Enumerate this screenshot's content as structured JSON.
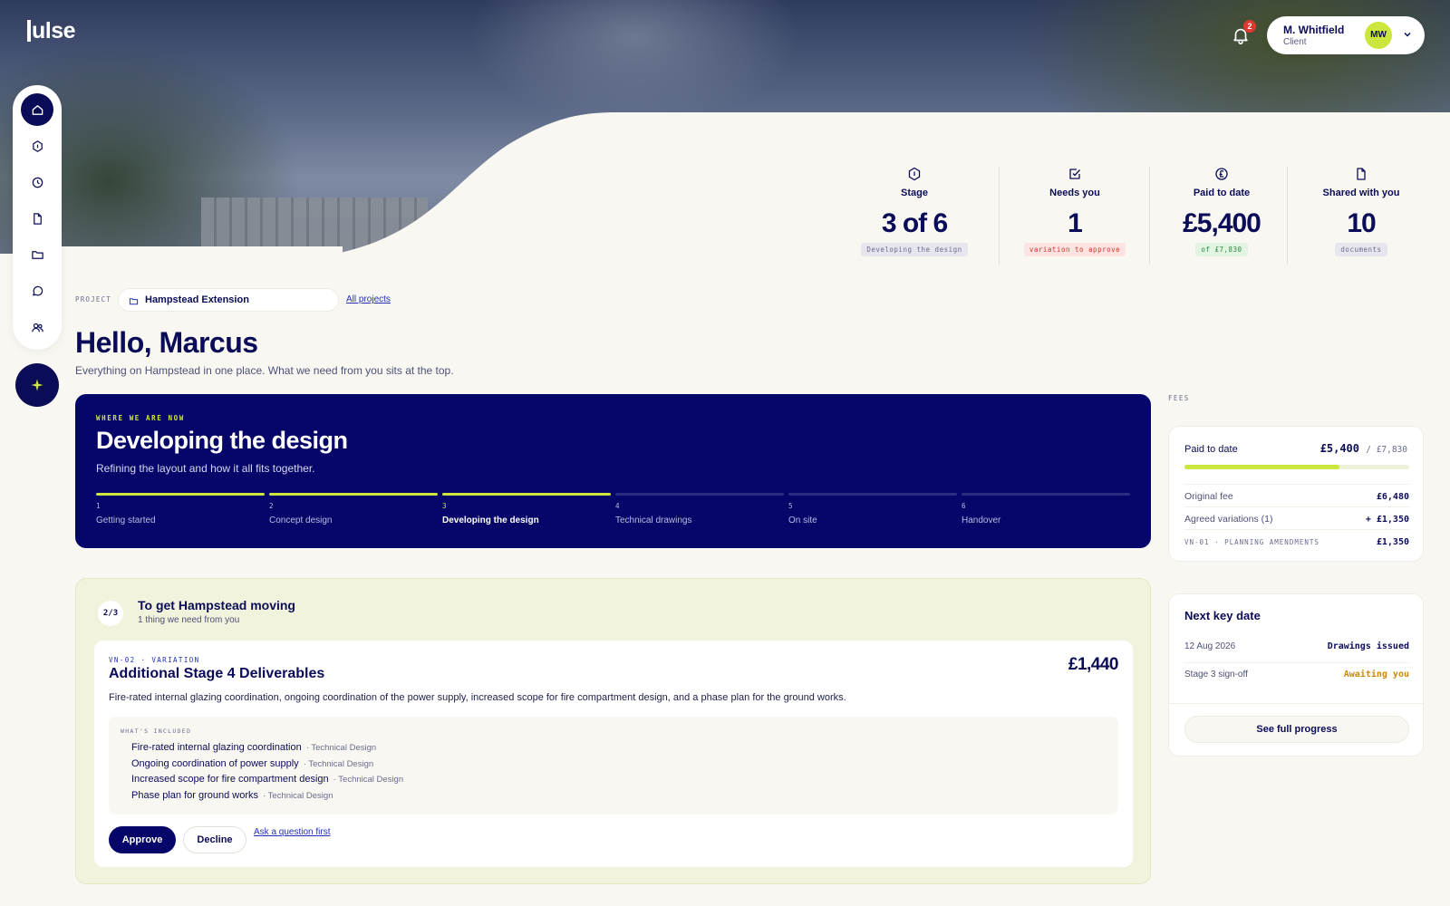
{
  "app": {
    "logo": "ulse"
  },
  "header": {
    "notification_count": "2",
    "user": {
      "name": "M. Whitfield",
      "role": "Client",
      "initials": "MW"
    }
  },
  "sidebar": {
    "items": [
      {
        "icon": "home-icon",
        "active": true
      },
      {
        "icon": "hexagon-info-icon"
      },
      {
        "icon": "clock-icon"
      },
      {
        "icon": "document-icon"
      },
      {
        "icon": "folder-icon"
      },
      {
        "icon": "chat-icon"
      },
      {
        "icon": "people-icon"
      }
    ],
    "fab_icon": "sparkle-icon"
  },
  "stats": [
    {
      "icon": "hexagon-info-icon",
      "label": "Stage",
      "value": "3 of 6",
      "chip": "Developing the design",
      "chip_bg": "#e7e6ee",
      "chip_fg": "#6a6c8e"
    },
    {
      "icon": "checkbox-icon",
      "label": "Needs you",
      "value": "1",
      "chip": "variation to approve",
      "chip_bg": "#fde4e2",
      "chip_fg": "#d2352a"
    },
    {
      "icon": "pound-circle-icon",
      "label": "Paid to date",
      "value": "£5,400",
      "chip": "of £7,830",
      "chip_bg": "#e2f4e2",
      "chip_fg": "#2e8a3c"
    },
    {
      "icon": "document-icon",
      "label": "Shared with you",
      "value": "10",
      "chip": "documents",
      "chip_bg": "#e7e6ee",
      "chip_fg": "#6a6c8e"
    }
  ],
  "project": {
    "label": "PROJECT",
    "name": "Hampstead Extension",
    "all_link": "All projects"
  },
  "greeting": {
    "title": "Hello, Marcus",
    "subtitle": "Everything on Hampstead in one place. What we need from you sits at the top."
  },
  "stage_card": {
    "eyebrow": "WHERE WE ARE NOW",
    "title": "Developing the design",
    "subtitle": "Refining the layout and how it all fits together.",
    "steps": [
      {
        "num": "1",
        "name": "Getting started",
        "state": "done"
      },
      {
        "num": "2",
        "name": "Concept design",
        "state": "done"
      },
      {
        "num": "3",
        "name": "Developing the design",
        "state": "current"
      },
      {
        "num": "4",
        "name": "Technical drawings",
        "state": "todo"
      },
      {
        "num": "5",
        "name": "On site",
        "state": "todo"
      },
      {
        "num": "6",
        "name": "Handover",
        "state": "todo"
      }
    ]
  },
  "action_panel": {
    "count": "2/3",
    "title": "To get Hampstead moving",
    "subtitle": "1 thing we need from you",
    "variation": {
      "eyebrow": "VN-02 · VARIATION",
      "title": "Additional Stage 4 Deliverables",
      "price": "£1,440",
      "description": "Fire-rated internal glazing coordination, ongoing coordination of the power supply, increased scope for fire compartment design, and a phase plan for the ground works.",
      "included_label": "WHAT'S INCLUDED",
      "included": [
        {
          "item": "Fire-rated internal glazing coordination",
          "tag": "· Technical Design"
        },
        {
          "item": "Ongoing coordination of power supply",
          "tag": "· Technical Design"
        },
        {
          "item": "Increased scope for fire compartment design",
          "tag": "· Technical Design"
        },
        {
          "item": "Phase plan for ground works",
          "tag": "· Technical Design"
        }
      ],
      "approve": "Approve",
      "decline": "Decline",
      "ask": "Ask a question first"
    }
  },
  "fees": {
    "label": "FEES",
    "paid_label": "Paid to date",
    "paid": "£5,400",
    "total": "/ £7,830",
    "progress": 0.69,
    "rows": [
      {
        "label": "Original fee",
        "value": "£6,480"
      },
      {
        "label": "Agreed variations (1)",
        "value": "+ £1,350"
      },
      {
        "label": "VN-01 · PLANNING AMENDMENTS",
        "value": "£1,350"
      }
    ]
  },
  "key_date": {
    "title": "Next key date",
    "rows": [
      {
        "label": "12 Aug 2026",
        "value": "Drawings issued",
        "color": "#0b0c57"
      },
      {
        "label": "Stage 3 sign-off",
        "value": "Awaiting you",
        "color": "#c98a0c"
      }
    ],
    "button": "See full progress"
  },
  "colors": {
    "navy": "#06066a",
    "lime": "#cde63e",
    "background": "#f8f7f1"
  }
}
